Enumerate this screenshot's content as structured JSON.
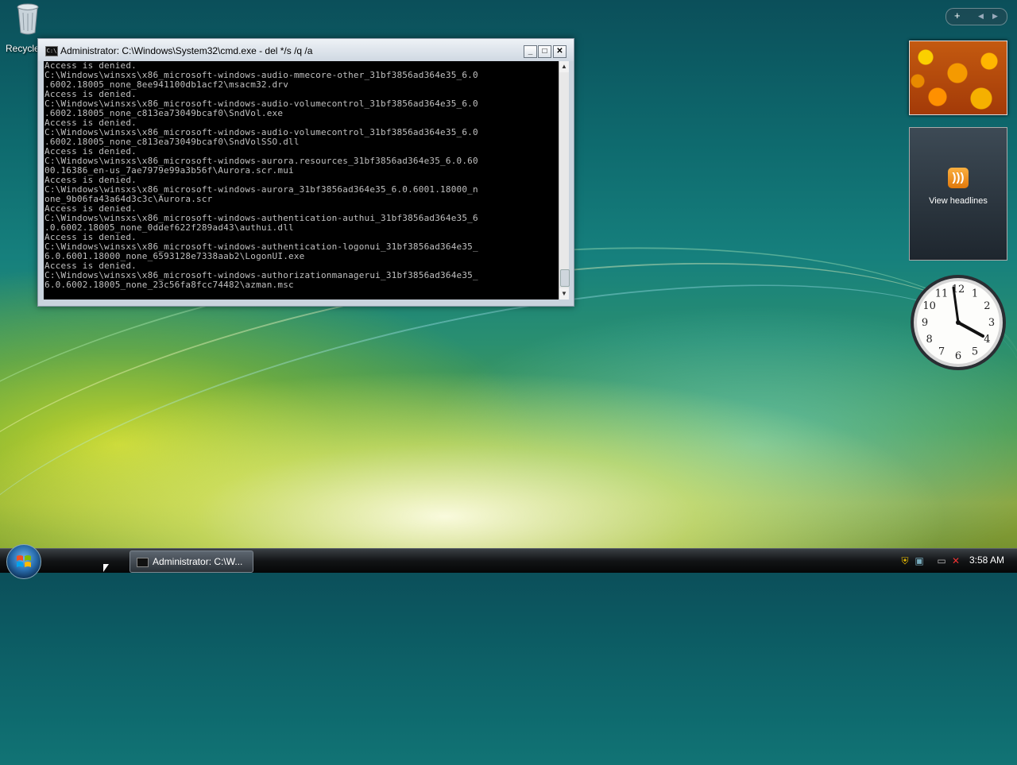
{
  "desktop": {
    "recycle_label": "Recycle"
  },
  "window": {
    "title": "Administrator: C:\\Windows\\System32\\cmd.exe - del  */s /q /a",
    "icon": "cmd-icon",
    "buttons": {
      "minimize": "_",
      "maximize": "□",
      "close": "✕"
    },
    "console_lines": [
      "Access is denied.",
      "C:\\Windows\\winsxs\\x86_microsoft-windows-audio-mmecore-other_31bf3856ad364e35_6.0",
      ".6002.18005_none_8ee941100db1acf2\\msacm32.drv",
      "Access is denied.",
      "C:\\Windows\\winsxs\\x86_microsoft-windows-audio-volumecontrol_31bf3856ad364e35_6.0",
      ".6002.18005_none_c813ea73049bcaf0\\SndVol.exe",
      "Access is denied.",
      "C:\\Windows\\winsxs\\x86_microsoft-windows-audio-volumecontrol_31bf3856ad364e35_6.0",
      ".6002.18005_none_c813ea73049bcaf0\\SndVolSSO.dll",
      "Access is denied.",
      "C:\\Windows\\winsxs\\x86_microsoft-windows-aurora.resources_31bf3856ad364e35_6.0.60",
      "00.16386_en-us_7ae7979e99a3b56f\\Aurora.scr.mui",
      "Access is denied.",
      "C:\\Windows\\winsxs\\x86_microsoft-windows-aurora_31bf3856ad364e35_6.0.6001.18000_n",
      "one_9b06fa43a64d3c3c\\Aurora.scr",
      "Access is denied.",
      "C:\\Windows\\winsxs\\x86_microsoft-windows-authentication-authui_31bf3856ad364e35_6",
      ".0.6002.18005_none_0ddef622f289ad43\\authui.dll",
      "Access is denied.",
      "C:\\Windows\\winsxs\\x86_microsoft-windows-authentication-logonui_31bf3856ad364e35_",
      "6.0.6001.18000_none_6593128e7338aab2\\LogonUI.exe",
      "Access is denied.",
      "C:\\Windows\\winsxs\\x86_microsoft-windows-authorizationmanagerui_31bf3856ad364e35_",
      "6.0.6002.18005_none_23c56fa8fcc74482\\azman.msc"
    ]
  },
  "sidebar": {
    "add_label": "+",
    "feed_label": "View headlines",
    "clock_numbers": [
      "12",
      "1",
      "2",
      "3",
      "4",
      "5",
      "6",
      "7",
      "8",
      "9",
      "10",
      "11"
    ]
  },
  "taskbar": {
    "task_label": "Administrator: C:\\W...",
    "time": "3:58 AM"
  },
  "colors": {
    "console_bg": "#000000",
    "console_text": "#c0c0c0",
    "accent": "#2a6fb0"
  }
}
